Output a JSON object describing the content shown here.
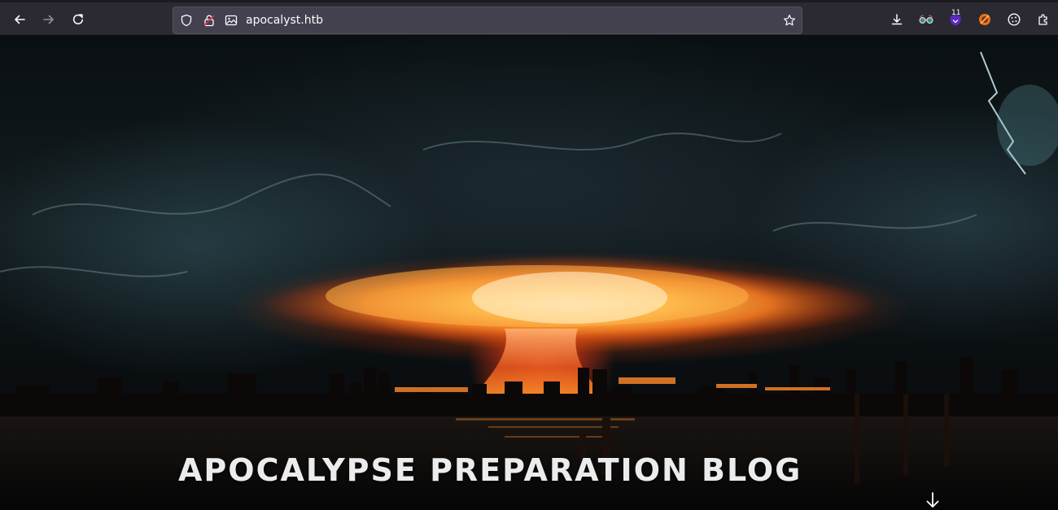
{
  "browser": {
    "url": "apocalyst.htb",
    "notification_count": "11",
    "icons": {
      "back": "arrow-left-icon",
      "forward": "arrow-right-icon",
      "reload": "reload-icon",
      "tracking_protection": "shield-icon",
      "connection": "lock-insecure-icon",
      "page_type": "image-icon",
      "bookmark": "star-icon",
      "downloads": "download-icon",
      "extension_1": "glasses-extension-icon",
      "extension_2": "shield-badge-extension-icon",
      "extension_3": "foxyproxy-extension-icon",
      "extension_4": "cookie-icon",
      "extensions": "puzzle-icon"
    }
  },
  "page": {
    "title": "APOCALYPSE PREPARATION BLOG",
    "scroll_icon": "arrow-down-icon"
  },
  "colors": {
    "toolbar": "#2b2a33",
    "urlbar": "#42414d",
    "title_text": "#ececec",
    "explosion_core": "#ffd36b",
    "explosion_outer": "#e2551a"
  }
}
